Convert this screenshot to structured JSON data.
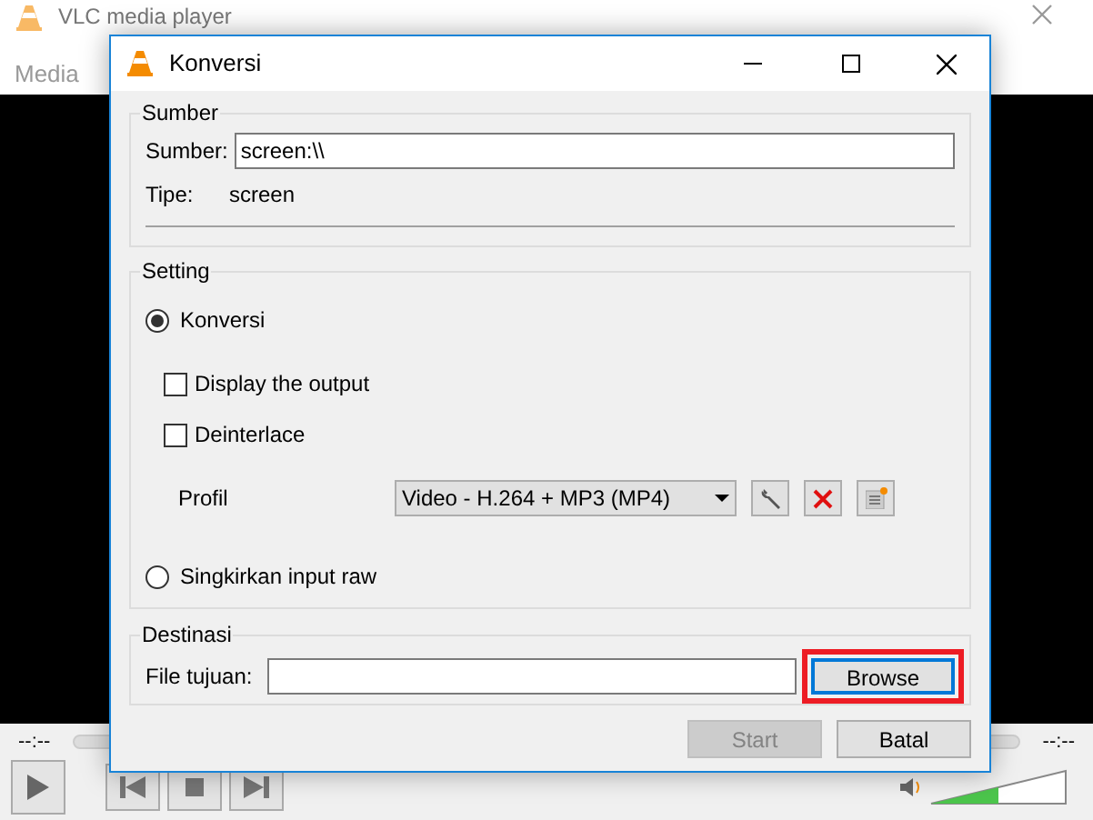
{
  "main_window": {
    "title": "VLC media player",
    "menu": [
      "Media"
    ],
    "time_elapsed": "--:--",
    "time_total": "--:--",
    "volume": {
      "level": 0.5
    }
  },
  "dialog": {
    "title": "Konversi",
    "source": {
      "heading": "Sumber",
      "label": "Sumber:",
      "value": "screen:\\\\",
      "type_label": "Tipe:",
      "type_value": "screen"
    },
    "settings": {
      "heading": "Setting",
      "convert": {
        "label": "Konversi",
        "selected": true
      },
      "checkboxes": [
        {
          "label": "Display the output",
          "checked": false
        },
        {
          "label": "Deinterlace",
          "checked": false
        }
      ],
      "profile_label": "Profil",
      "profile_value": "Video - H.264 + MP3 (MP4)",
      "raw": {
        "label": "Singkirkan input raw",
        "selected": false
      }
    },
    "destination": {
      "heading": "Destinasi",
      "label": "File tujuan:",
      "button": "Browse",
      "highlighted": true
    },
    "buttons": [
      {
        "label": "Start",
        "disabled": true
      },
      {
        "label": "Batal",
        "disabled": false
      }
    ]
  }
}
